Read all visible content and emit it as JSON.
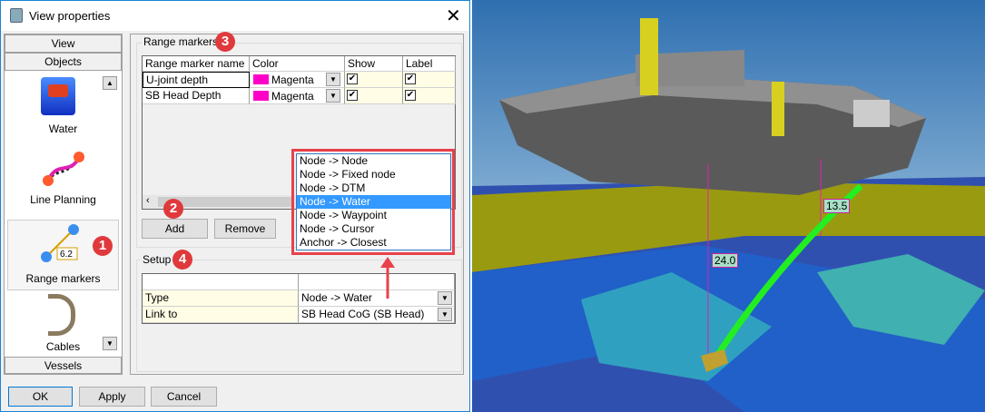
{
  "title": "View properties",
  "sidebar": {
    "tabs": {
      "view": "View",
      "objects": "Objects",
      "vessels": "Vessels"
    },
    "items": [
      {
        "label": "Water"
      },
      {
        "label": "Line Planning"
      },
      {
        "label": "Range markers",
        "icon_value": "6.2"
      },
      {
        "label": "Cables"
      }
    ]
  },
  "range_markers": {
    "group_label": "Range markers",
    "columns": [
      "Range marker name",
      "Color",
      "Show",
      "Label"
    ],
    "rows": [
      {
        "name": "U-joint depth",
        "color": "Magenta",
        "show": true,
        "label": true
      },
      {
        "name": "SB Head Depth",
        "color": "Magenta",
        "show": true,
        "label": true
      }
    ],
    "add": "Add",
    "remove": "Remove"
  },
  "color_swatch": "#ff00c8",
  "dropdown": {
    "options": [
      "Node -> Node",
      "Node -> Fixed node",
      "Node -> DTM",
      "Node -> Water",
      "Node -> Waypoint",
      "Node -> Cursor",
      "Anchor -> Closest"
    ],
    "selected": 3
  },
  "setup": {
    "group_label": "Setup",
    "rows": [
      {
        "key": "Type",
        "value": "Node -> Water"
      },
      {
        "key": "Link to",
        "value": "SB Head CoG (SB Head)"
      }
    ]
  },
  "footer": {
    "ok": "OK",
    "apply": "Apply",
    "cancel": "Cancel"
  },
  "badges": [
    "1",
    "2",
    "3",
    "4"
  ],
  "scene": {
    "labels": [
      "13.5",
      "24.0"
    ]
  }
}
